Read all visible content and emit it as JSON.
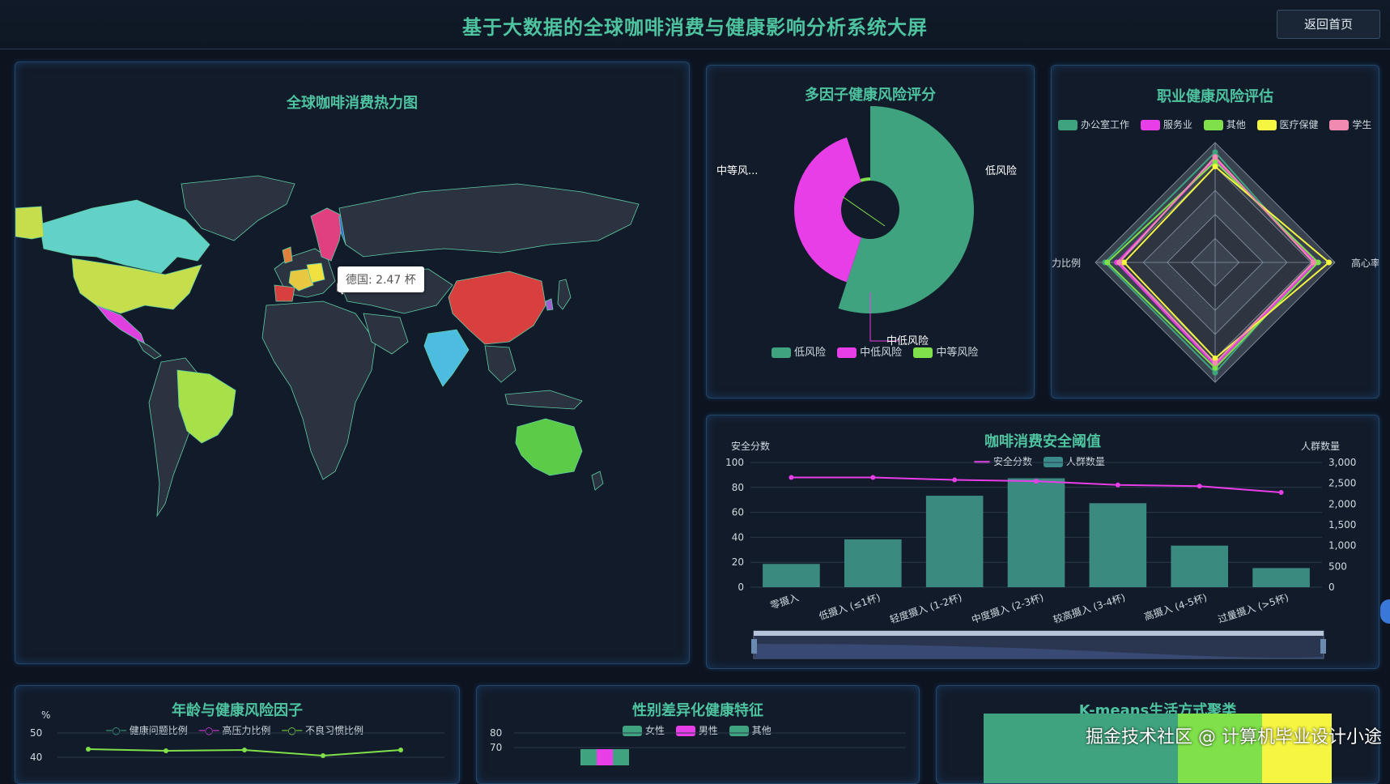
{
  "header": {
    "title": "基于大数据的全球咖啡消费与健康影响分析系统大屏",
    "back_label": "返回首页"
  },
  "map_panel": {
    "title": "全球咖啡消费热力图",
    "tooltip": "德国: 2.47 杯"
  },
  "risk_panel": {
    "title": "多因子健康风险评分",
    "labels": {
      "low": "低风险",
      "mid": "中等风...",
      "midlow": "中低风险"
    },
    "legend": [
      "低风险",
      "中低风险",
      "中等风险"
    ],
    "colors": [
      "#3fa37f",
      "#e83ee8",
      "#7fe04a"
    ]
  },
  "job_panel": {
    "title": "职业健康风险评估",
    "legend": [
      {
        "name": "办公室工作",
        "color": "#3fa37f"
      },
      {
        "name": "服务业",
        "color": "#e83ee8"
      },
      {
        "name": "其他",
        "color": "#7fe04a"
      },
      {
        "name": "医疗保健",
        "color": "#f5f542"
      },
      {
        "name": "学生",
        "color": "#f08ab0"
      }
    ],
    "axis_labels": {
      "left": "力比例",
      "right": "高心率"
    }
  },
  "safety_panel": {
    "title": "咖啡消费安全阈值",
    "left_axis_title": "安全分数",
    "right_axis_title": "人群数量",
    "legend": {
      "line": "安全分数",
      "bar": "人群数量"
    }
  },
  "age_panel": {
    "title": "年龄与健康风险因子",
    "unit": "%",
    "legend": [
      "健康问题比例",
      "高压力比例",
      "不良习惯比例"
    ],
    "y_ticks": [
      "50",
      "40"
    ]
  },
  "gender_panel": {
    "title": "性别差异化健康特征",
    "legend": [
      "女性",
      "男性",
      "其他"
    ],
    "y_ticks": [
      "80",
      "70"
    ]
  },
  "kmeans_panel": {
    "title": "K-means生活方式聚类"
  },
  "watermark": "掘金技术社区 @ 计算机毕业设计小途",
  "chart_data": [
    {
      "type": "pie",
      "title": "多因子健康风险评分",
      "categories": [
        "低风险",
        "中低风险",
        "中等风险"
      ],
      "values": [
        55,
        40,
        5
      ]
    },
    {
      "type": "bar",
      "title": "咖啡消费安全阈值",
      "categories": [
        "零摄入",
        "低摄入 (≤1杯)",
        "轻度摄入 (1-2杯)",
        "中度摄入 (2-3杯)",
        "较高摄入 (3-4杯)",
        "高摄入 (4-5杯)",
        "过量摄入 (>5杯)"
      ],
      "series": [
        {
          "name": "安全分数",
          "type": "line",
          "axis": "left",
          "values": [
            88,
            88,
            86,
            85,
            82,
            81,
            76
          ]
        },
        {
          "name": "人群数量",
          "type": "bar",
          "axis": "right",
          "values": [
            560,
            1150,
            2200,
            2620,
            2020,
            1000,
            460
          ]
        }
      ],
      "left_ylim": [
        0,
        100
      ],
      "left_ticks": [
        "0",
        "20",
        "40",
        "60",
        "80",
        "100"
      ],
      "right_ylim": [
        0,
        3000
      ],
      "right_ticks": [
        "0",
        "500",
        "1,000",
        "1,500",
        "2,000",
        "2,500",
        "3,000"
      ]
    }
  ]
}
